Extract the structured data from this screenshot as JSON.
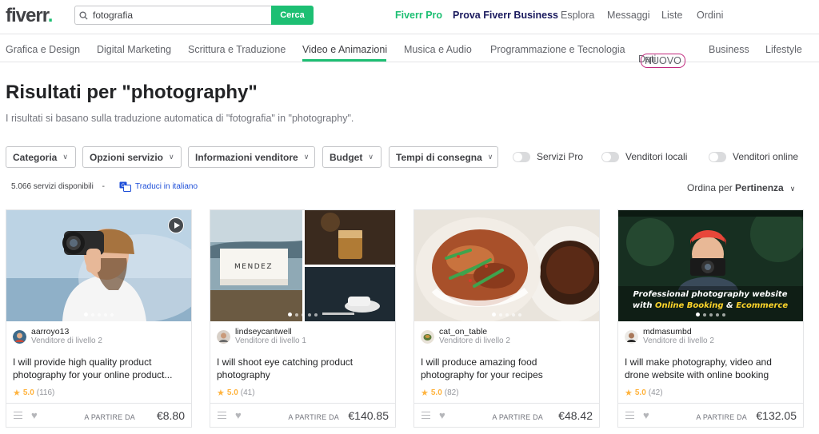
{
  "header": {
    "logo": "fiverr",
    "logo_dot": ".",
    "search_value": "fotografia",
    "search_button": "Cerca",
    "links": {
      "pro": "Fiverr Pro",
      "business": "Prova Fiverr Business",
      "explore": "Esplora",
      "messages": "Messaggi",
      "lists": "Liste",
      "orders": "Ordini"
    }
  },
  "categories": [
    "Grafica e Design",
    "Digital Marketing",
    "Scrittura e Traduzione",
    "Video e Animazioni",
    "Musica e Audio",
    "Programmazione e Tecnologia",
    "Dati",
    "Business",
    "Lifestyle"
  ],
  "new_badge": "NUOVO",
  "page": {
    "title": "Risultati per \"photography\"",
    "subtitle": "I risultati si basano sulla traduzione automatica di \"fotografia\" in \"photography\"."
  },
  "filters": [
    "Categoria",
    "Opzioni servizio",
    "Informazioni venditore",
    "Budget",
    "Tempi di consegna"
  ],
  "toggles": [
    "Servizi Pro",
    "Venditori locali",
    "Venditori online"
  ],
  "results": {
    "count": "5.066 servizi disponibili",
    "separator": "-",
    "translate": "Traduci in italiano",
    "sort_label": "Ordina per",
    "sort_value": "Pertinenza"
  },
  "colors": {
    "accent": "#1dbf73",
    "star": "#ffb33e",
    "new_badge": "#c1287d"
  },
  "gigs": [
    {
      "seller": "aarroyo13",
      "level": "Venditore di livello 2",
      "title": "I will provide high quality product photography for your online product...",
      "rating": "5.0",
      "reviews": "(116)",
      "price_from": "A PARTIRE DA",
      "price": "€8.80"
    },
    {
      "seller": "lindseycantwell",
      "level": "Venditore di livello 1",
      "title": "I will shoot eye catching product photography",
      "rating": "5.0",
      "reviews": "(41)",
      "price_from": "A PARTIRE DA",
      "price": "€140.85",
      "image_text": "MENDEZ"
    },
    {
      "seller": "cat_on_table",
      "level": "Venditore di livello 2",
      "title": "I will produce amazing food photography for your recipes",
      "rating": "5.0",
      "reviews": "(82)",
      "price_from": "A PARTIRE DA",
      "price": "€48.42"
    },
    {
      "seller": "mdmasumbd",
      "level": "Venditore di livello 2",
      "title": "I will make photography, video and drone website with online booking",
      "rating": "5.0",
      "reviews": "(42)",
      "price_from": "A PARTIRE DA",
      "price": "€132.05",
      "image_text_line1": "Professional photography website",
      "image_text_with": "with",
      "image_text_online": "Online Booking",
      "image_text_amp": "&",
      "image_text_ecom": "Ecommerce"
    }
  ]
}
